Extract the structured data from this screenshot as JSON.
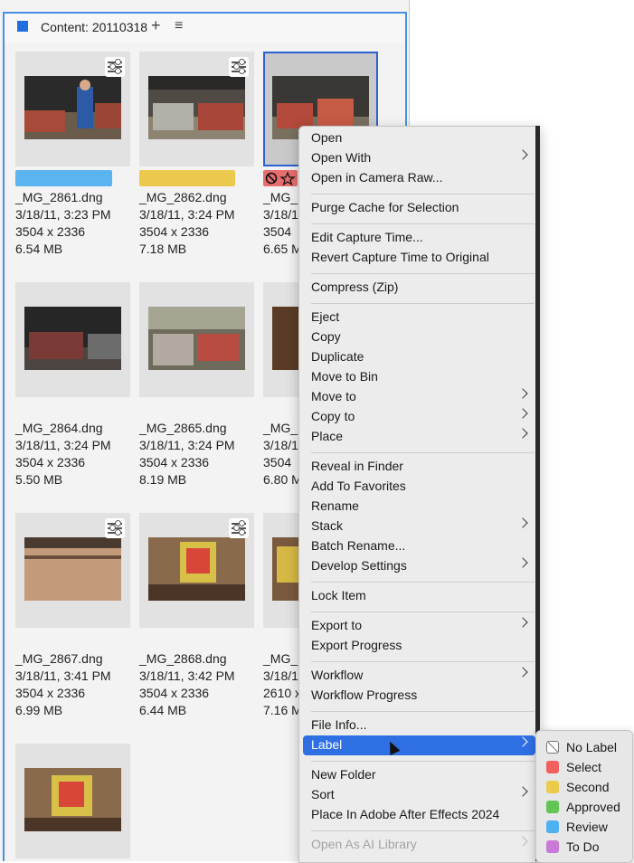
{
  "panel": {
    "title": "Content: 20110318",
    "add_icon": "plus-icon",
    "menu_icon": "hamburger-icon"
  },
  "thumbnails": [
    {
      "name": "_MG_2861.dng",
      "date": "3/18/11, 3:23 PM",
      "dims": "3504 x 2336",
      "size": "6.54 MB",
      "label_color": "#5bb4f0",
      "adjusted": true
    },
    {
      "name": "_MG_2862.dng",
      "date": "3/18/11, 3:24 PM",
      "dims": "3504 x 2336",
      "size": "7.18 MB",
      "label_color": "#ebc94c",
      "adjusted": true
    },
    {
      "name": "_MG_",
      "date": "3/18/1",
      "dims": "3504",
      "size": "6.65 M",
      "rejected": true
    },
    {
      "name": "_MG_2864.dng",
      "date": "3/18/11, 3:24 PM",
      "dims": "3504 x 2336",
      "size": "5.50 MB"
    },
    {
      "name": "_MG_2865.dng",
      "date": "3/18/11, 3:24 PM",
      "dims": "3504 x 2336",
      "size": "8.19 MB"
    },
    {
      "name": "_MG_",
      "date": "3/18/1",
      "dims": "3504",
      "size": "6.80 M"
    },
    {
      "name": "_MG_2867.dng",
      "date": "3/18/11, 3:41 PM",
      "dims": "3504 x 2336",
      "size": "6.99 MB",
      "adjusted": true
    },
    {
      "name": "_MG_2868.dng",
      "date": "3/18/11, 3:42 PM",
      "dims": "3504 x 2336",
      "size": "6.44 MB",
      "adjusted": true
    },
    {
      "name": "_MG_",
      "date": "3/18/1",
      "dims": "2610 x",
      "size": "7.16 M"
    }
  ],
  "context_menu": {
    "items": [
      {
        "label": "Open"
      },
      {
        "label": "Open With",
        "submenu": true
      },
      {
        "label": "Open in Camera Raw..."
      },
      {
        "label": "Purge Cache for Selection"
      },
      {
        "label": "Edit Capture Time..."
      },
      {
        "label": "Revert Capture Time to Original"
      },
      {
        "label": "Compress (Zip)"
      },
      {
        "label": "Eject"
      },
      {
        "label": "Copy"
      },
      {
        "label": "Duplicate"
      },
      {
        "label": "Move to Bin"
      },
      {
        "label": "Move to",
        "submenu": true
      },
      {
        "label": "Copy to",
        "submenu": true
      },
      {
        "label": "Place",
        "submenu": true
      },
      {
        "label": "Reveal in Finder"
      },
      {
        "label": "Add To Favorites"
      },
      {
        "label": "Rename"
      },
      {
        "label": "Stack",
        "submenu": true
      },
      {
        "label": "Batch Rename..."
      },
      {
        "label": "Develop Settings",
        "submenu": true
      },
      {
        "label": "Lock Item"
      },
      {
        "label": "Export to",
        "submenu": true
      },
      {
        "label": "Export Progress"
      },
      {
        "label": "Workflow",
        "submenu": true
      },
      {
        "label": "Workflow Progress"
      },
      {
        "label": "File Info..."
      },
      {
        "label": "Label",
        "submenu": true,
        "highlighted": true
      },
      {
        "label": "New Folder"
      },
      {
        "label": "Sort",
        "submenu": true
      },
      {
        "label": "Place In Adobe After Effects 2024"
      },
      {
        "label": "Open As AI Library",
        "submenu": true,
        "disabled": true
      }
    ]
  },
  "label_submenu": {
    "items": [
      {
        "label": "No Label",
        "color": "none"
      },
      {
        "label": "Select",
        "color": "#f0605f"
      },
      {
        "label": "Second",
        "color": "#eacb4a"
      },
      {
        "label": "Approved",
        "color": "#62c554"
      },
      {
        "label": "Review",
        "color": "#4fb0f0"
      },
      {
        "label": "To Do",
        "color": "#c87ad6"
      }
    ]
  }
}
